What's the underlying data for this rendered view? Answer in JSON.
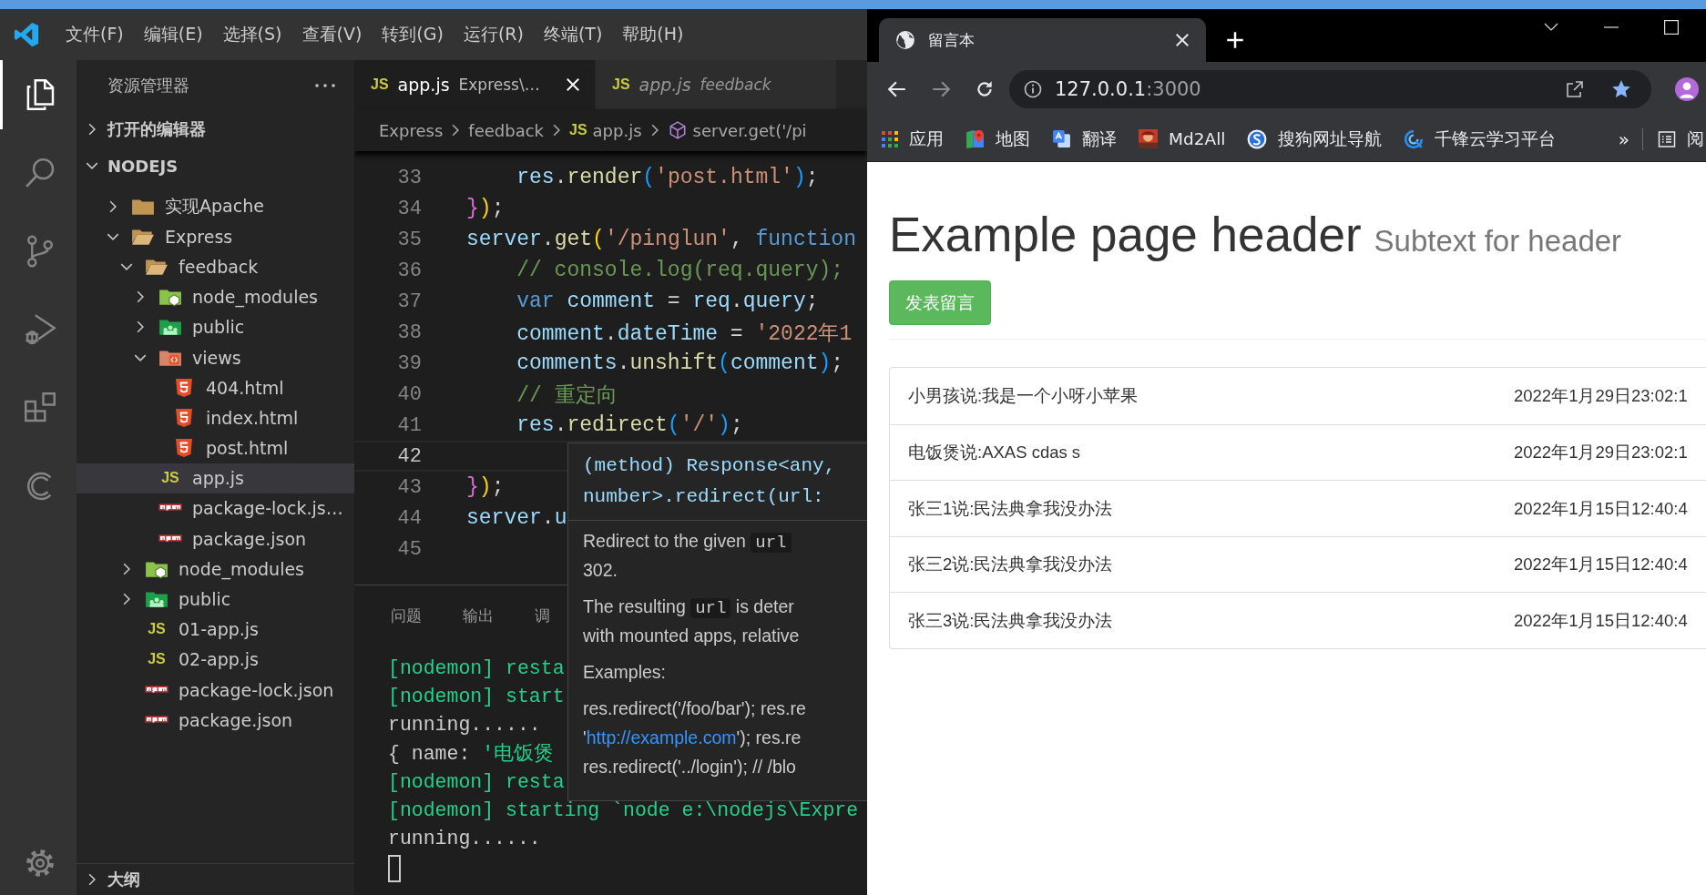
{
  "vscode": {
    "menu": [
      "文件(F)",
      "编辑(E)",
      "选择(S)",
      "查看(V)",
      "转到(G)",
      "运行(R)",
      "终端(T)",
      "帮助(H)"
    ],
    "activity_bar": [
      {
        "kind": "files",
        "selected": true
      },
      {
        "kind": "search",
        "selected": false
      },
      {
        "kind": "source-control",
        "selected": false
      },
      {
        "kind": "run-debug",
        "selected": false
      },
      {
        "kind": "extensions",
        "selected": false
      },
      {
        "kind": "crescent",
        "selected": false
      }
    ],
    "sidebar": {
      "title": "资源管理器",
      "sections": [
        {
          "title": "打开的编辑器",
          "expanded": false
        },
        {
          "title": "NODEJS",
          "expanded": true
        }
      ],
      "tree": [
        {
          "label": "实现Apache",
          "kind": "folder",
          "expanded": false,
          "selected": false
        },
        {
          "label": "Express",
          "kind": "folder",
          "expanded": true,
          "selected": false,
          "children": [
            {
              "label": "feedback",
              "kind": "folder",
              "expanded": true,
              "selected": false,
              "children": [
                {
                  "label": "node_modules",
                  "kind": "node-folder",
                  "expanded": false,
                  "selected": false
                },
                {
                  "label": "public",
                  "kind": "public-folder",
                  "expanded": false,
                  "selected": false
                },
                {
                  "label": "views",
                  "kind": "views-folder",
                  "expanded": true,
                  "selected": false,
                  "children": [
                    {
                      "label": "404.html",
                      "kind": "html",
                      "selected": false
                    },
                    {
                      "label": "index.html",
                      "kind": "html",
                      "selected": false
                    },
                    {
                      "label": "post.html",
                      "kind": "html",
                      "selected": false
                    }
                  ]
                },
                {
                  "label": "app.js",
                  "kind": "js",
                  "badge": "JS",
                  "selected": true
                },
                {
                  "label": "package-lock.js…",
                  "kind": "npm",
                  "selected": false
                },
                {
                  "label": "package.json",
                  "kind": "npm",
                  "selected": false
                }
              ]
            },
            {
              "label": "node_modules",
              "kind": "node-folder",
              "expanded": false,
              "selected": false
            },
            {
              "label": "public",
              "kind": "public-folder",
              "expanded": false,
              "selected": false
            },
            {
              "label": "01-app.js",
              "kind": "js",
              "badge": "JS",
              "selected": false
            },
            {
              "label": "02-app.js",
              "kind": "js",
              "badge": "JS",
              "selected": false
            },
            {
              "label": "package-lock.json",
              "kind": "npm",
              "selected": false
            },
            {
              "label": "package.json",
              "kind": "npm",
              "selected": false
            }
          ]
        }
      ],
      "outline": {
        "title": "大纲",
        "expanded": false
      }
    },
    "tabs": [
      {
        "badge": "JS",
        "label": "app.js",
        "description": "Express\\…",
        "selected": true,
        "preview": false
      },
      {
        "badge": "JS",
        "label": "app.js",
        "description": "feedback",
        "selected": false,
        "preview": true
      }
    ],
    "breadcrumbs": [
      {
        "kind": "folder",
        "label": "Express"
      },
      {
        "kind": "folder",
        "label": "feedback"
      },
      {
        "kind": "js",
        "badge": "JS",
        "label": "app.js"
      },
      {
        "kind": "method",
        "label": "server.get('/pi"
      }
    ],
    "code": [
      {
        "number": "33",
        "current": false,
        "tokens": [
          {
            "kind": "var",
            "text": "    res"
          },
          {
            "kind": "plain",
            "text": "."
          },
          {
            "kind": "fn",
            "text": "render"
          },
          {
            "kind": "p3",
            "text": "("
          },
          {
            "kind": "str",
            "text": "'post.html'"
          },
          {
            "kind": "p3",
            "text": ")"
          },
          {
            "kind": "plain",
            "text": ";"
          }
        ]
      },
      {
        "number": "34",
        "current": false,
        "tokens": [
          {
            "kind": "p2",
            "text": "}"
          },
          {
            "kind": "p1",
            "text": ")"
          },
          {
            "kind": "plain",
            "text": ";"
          }
        ]
      },
      {
        "number": "35",
        "current": false,
        "tokens": [
          {
            "kind": "var",
            "text": "server"
          },
          {
            "kind": "plain",
            "text": "."
          },
          {
            "kind": "fn",
            "text": "get"
          },
          {
            "kind": "p1",
            "text": "("
          },
          {
            "kind": "str",
            "text": "'/pinglun'"
          },
          {
            "kind": "plain",
            "text": ", "
          },
          {
            "kind": "kw",
            "text": "function"
          }
        ]
      },
      {
        "number": "36",
        "current": false,
        "tokens": [
          {
            "kind": "comment",
            "text": "    // console.log(req.query);"
          }
        ]
      },
      {
        "number": "37",
        "current": false,
        "tokens": [
          {
            "kind": "kw",
            "text": "    var "
          },
          {
            "kind": "var",
            "text": "comment"
          },
          {
            "kind": "plain",
            "text": " = "
          },
          {
            "kind": "var",
            "text": "req"
          },
          {
            "kind": "plain",
            "text": "."
          },
          {
            "kind": "var",
            "text": "query"
          },
          {
            "kind": "plain",
            "text": ";"
          }
        ]
      },
      {
        "number": "38",
        "current": false,
        "tokens": [
          {
            "kind": "var",
            "text": "    comment"
          },
          {
            "kind": "plain",
            "text": "."
          },
          {
            "kind": "var",
            "text": "dateTime"
          },
          {
            "kind": "plain",
            "text": " = "
          },
          {
            "kind": "str",
            "text": "'2022年1"
          }
        ]
      },
      {
        "number": "39",
        "current": false,
        "tokens": [
          {
            "kind": "var",
            "text": "    comments"
          },
          {
            "kind": "plain",
            "text": "."
          },
          {
            "kind": "fn",
            "text": "unshift"
          },
          {
            "kind": "p3",
            "text": "("
          },
          {
            "kind": "var",
            "text": "comment"
          },
          {
            "kind": "p3",
            "text": ")"
          },
          {
            "kind": "plain",
            "text": ";"
          }
        ]
      },
      {
        "number": "40",
        "current": false,
        "tokens": [
          {
            "kind": "comment",
            "text": "    // 重定向"
          }
        ]
      },
      {
        "number": "41",
        "current": false,
        "tokens": [
          {
            "kind": "var",
            "text": "    res"
          },
          {
            "kind": "plain",
            "text": "."
          },
          {
            "kind": "fn",
            "text": "redirect"
          },
          {
            "kind": "p3",
            "text": "("
          },
          {
            "kind": "str",
            "text": "'/'"
          },
          {
            "kind": "p3",
            "text": ")"
          },
          {
            "kind": "plain",
            "text": ";"
          }
        ]
      },
      {
        "number": "42",
        "current": true
      },
      {
        "number": "43",
        "current": false,
        "tokens": [
          {
            "kind": "p2",
            "text": "}"
          },
          {
            "kind": "p1",
            "text": ")"
          },
          {
            "kind": "plain",
            "text": ";"
          }
        ]
      },
      {
        "number": "44",
        "current": false,
        "tokens": [
          {
            "kind": "var",
            "text": "server"
          },
          {
            "kind": "plain",
            "text": "."
          },
          {
            "kind": "var",
            "text": "u"
          }
        ]
      },
      {
        "number": "45",
        "current": false
      }
    ],
    "hover": {
      "signature": [
        "(method) Response<any,",
        "number>.redirect(url:"
      ],
      "blocks": [
        {
          "lines": [
            {
              "parts": [
                {
                  "kind": "text",
                  "text": "Redirect to the given "
                },
                {
                  "kind": "code",
                  "text": "url"
                }
              ]
            },
            {
              "parts": [
                {
                  "kind": "text",
                  "text": "302."
                }
              ]
            }
          ]
        },
        {
          "lines": [
            {
              "parts": [
                {
                  "kind": "text",
                  "text": "The resulting "
                },
                {
                  "kind": "code",
                  "text": "url"
                },
                {
                  "kind": "text",
                  "text": " is deter"
                }
              ]
            },
            {
              "parts": [
                {
                  "kind": "text",
                  "text": "with mounted apps, relative"
                }
              ]
            }
          ]
        },
        {
          "lines": [
            {
              "parts": [
                {
                  "kind": "text",
                  "text": "Examples:"
                }
              ]
            }
          ]
        },
        {
          "lines": [
            {
              "parts": [
                {
                  "kind": "text",
                  "text": "res.redirect('/foo/bar'); res.re"
                }
              ]
            },
            {
              "parts": [
                {
                  "kind": "text",
                  "text": "'"
                },
                {
                  "kind": "link",
                  "text": "http://example.com"
                },
                {
                  "kind": "text",
                  "text": "'); res.re"
                }
              ]
            },
            {
              "parts": [
                {
                  "kind": "text",
                  "text": "res.redirect('../login'); // /blo"
                }
              ]
            }
          ]
        }
      ]
    },
    "panel_tabs": [
      {
        "label": "问题",
        "selected": false
      },
      {
        "label": "输出",
        "selected": false
      },
      {
        "label": "调",
        "selected": false
      }
    ],
    "terminal": [
      {
        "parts": [
          {
            "kind": "green",
            "text": "[nodemon] resta"
          }
        ]
      },
      {
        "parts": [
          {
            "kind": "green",
            "text": "[nodemon] start"
          }
        ]
      },
      {
        "parts": [
          {
            "kind": "plain",
            "text": "running......"
          }
        ]
      },
      {
        "parts": [
          {
            "kind": "plain",
            "text": "{ name: "
          },
          {
            "kind": "green",
            "text": "'电饭煲"
          }
        ]
      },
      {
        "parts": [
          {
            "kind": "green",
            "text": "[nodemon] resta"
          }
        ]
      },
      {
        "parts": [
          {
            "kind": "green",
            "text": "[nodemon] starting `node e:\\nodejs\\Expre"
          }
        ]
      },
      {
        "parts": [
          {
            "kind": "plain",
            "text": "running......"
          }
        ]
      }
    ]
  },
  "browser": {
    "tabs": [
      {
        "title": "留言本",
        "selected": true
      }
    ],
    "address": {
      "host": "127.0.0.1",
      "port": ":3000"
    },
    "bookmarked": true,
    "bookmarks": [
      {
        "kind": "apps",
        "label": "应用"
      },
      {
        "kind": "maps",
        "label": "地图"
      },
      {
        "kind": "translate",
        "label": "翻译"
      },
      {
        "label": "Md2All"
      },
      {
        "kind": "sogou",
        "label": "搜狗网址导航"
      },
      {
        "kind": "swirl",
        "label": "千锋云学习平台"
      }
    ],
    "more_bookmarks": "»",
    "reading_list": "阅",
    "page": {
      "header": "Example page header",
      "subtext": "Subtext for header",
      "button": "发表留言",
      "comments": [
        {
          "text": "小男孩说:我是一个小呀小苹果",
          "time": "2022年1月29日23:02:1"
        },
        {
          "text": "电饭煲说:AXAS cdas s",
          "time": "2022年1月29日23:02:1"
        },
        {
          "text": "张三1说:民法典拿我没办法",
          "time": "2022年1月15日12:40:4"
        },
        {
          "text": "张三2说:民法典拿我没办法",
          "time": "2022年1月15日12:40:4"
        },
        {
          "text": "张三3说:民法典拿我没办法",
          "time": "2022年1月15日12:40:4"
        }
      ]
    }
  }
}
